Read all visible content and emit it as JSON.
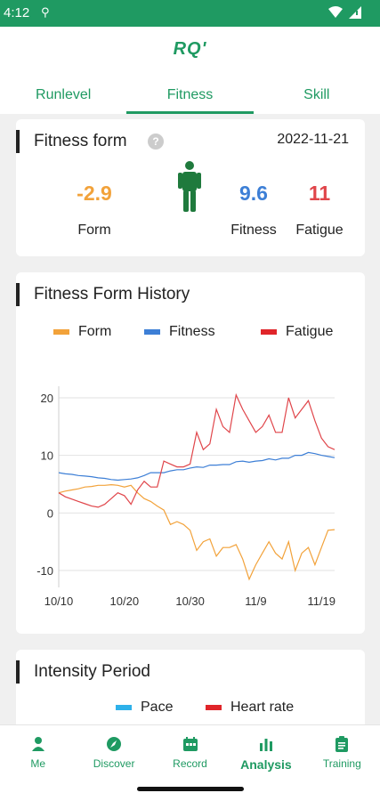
{
  "status_bar": {
    "time": "4:12",
    "usb_icon": "usb-icon"
  },
  "header": {
    "logo": "RQ'"
  },
  "tabs": [
    {
      "label": "Runlevel",
      "active": false
    },
    {
      "label": "Fitness",
      "active": true
    },
    {
      "label": "Skill",
      "active": false
    }
  ],
  "fitness_form": {
    "title": "Fitness form",
    "date": "2022-11-21",
    "form": {
      "value": "-2.9",
      "label": "Form",
      "color": "#f2a23a"
    },
    "fitness": {
      "value": "9.6",
      "label": "Fitness",
      "color": "#3d7fd6"
    },
    "fatigue": {
      "value": "11",
      "label": "Fatigue",
      "color": "#e0454a"
    },
    "person_color": "#1f7a3d"
  },
  "history": {
    "title": "Fitness Form History",
    "legend": [
      {
        "name": "Form",
        "color": "#f2a23a"
      },
      {
        "name": "Fitness",
        "color": "#3d7fd6"
      },
      {
        "name": "Fatigue",
        "color": "#e0454a"
      }
    ]
  },
  "chart_data": {
    "type": "line",
    "x": [
      "10/10",
      "10/11",
      "10/12",
      "10/13",
      "10/14",
      "10/15",
      "10/16",
      "10/17",
      "10/18",
      "10/19",
      "10/20",
      "10/21",
      "10/22",
      "10/23",
      "10/24",
      "10/25",
      "10/26",
      "10/27",
      "10/28",
      "10/29",
      "10/30",
      "10/31",
      "11/1",
      "11/2",
      "11/3",
      "11/4",
      "11/5",
      "11/6",
      "11/7",
      "11/8",
      "11/9",
      "11/10",
      "11/11",
      "11/12",
      "11/13",
      "11/14",
      "11/15",
      "11/16",
      "11/17",
      "11/18",
      "11/19",
      "11/20",
      "11/21"
    ],
    "xticks": [
      "10/10",
      "10/20",
      "10/30",
      "11/9",
      "11/19"
    ],
    "yticks": [
      -10,
      0,
      10,
      20
    ],
    "ylim": [
      -12,
      22
    ],
    "series": [
      {
        "name": "Form",
        "color": "#f2a23a",
        "values": [
          3.5,
          3.8,
          4.0,
          4.2,
          4.5,
          4.6,
          4.8,
          4.8,
          4.9,
          4.8,
          4.5,
          4.8,
          3.5,
          2.5,
          2.0,
          1.2,
          0.5,
          -2.0,
          -1.5,
          -2.0,
          -3.0,
          -6.5,
          -5.0,
          -4.5,
          -7.5,
          -6.0,
          -6.0,
          -5.5,
          -8.0,
          -11.5,
          -9.0,
          -7.0,
          -5.0,
          -7.0,
          -8.0,
          -5.0,
          -10.0,
          -7.0,
          -6.0,
          -9.0,
          -6.0,
          -3.0,
          -2.9
        ]
      },
      {
        "name": "Fitness",
        "color": "#3d7fd6",
        "values": [
          7.0,
          6.8,
          6.7,
          6.5,
          6.4,
          6.3,
          6.1,
          6.0,
          5.8,
          5.7,
          5.8,
          5.9,
          6.1,
          6.5,
          7.0,
          7.0,
          7.0,
          7.3,
          7.5,
          7.5,
          7.8,
          8.0,
          7.9,
          8.3,
          8.3,
          8.4,
          8.4,
          8.9,
          9.0,
          8.8,
          9.0,
          9.1,
          9.4,
          9.2,
          9.5,
          9.5,
          10.0,
          10.0,
          10.5,
          10.3,
          10.0,
          9.8,
          9.6
        ]
      },
      {
        "name": "Fatigue",
        "color": "#e0454a",
        "values": [
          3.5,
          2.8,
          2.4,
          2.0,
          1.6,
          1.2,
          1.0,
          1.5,
          2.5,
          3.5,
          3.0,
          1.5,
          4.0,
          5.5,
          4.5,
          4.5,
          9.0,
          8.5,
          8.0,
          8.0,
          8.5,
          14.0,
          11.0,
          12.0,
          18.0,
          15.0,
          14.0,
          20.5,
          18.0,
          16.0,
          14.0,
          15.0,
          17.0,
          14.0,
          14.0,
          20.0,
          16.5,
          18.0,
          19.5,
          16.0,
          13.0,
          11.5,
          11.0
        ]
      }
    ]
  },
  "intensity": {
    "title": "Intensity Period",
    "legend": [
      {
        "name": "Pace",
        "color": "#2eb1ea"
      },
      {
        "name": "Heart rate",
        "color": "#e0252a"
      }
    ]
  },
  "bottom_nav": [
    {
      "label": "Me",
      "icon": "person-icon",
      "active": false
    },
    {
      "label": "Discover",
      "icon": "compass-icon",
      "active": false
    },
    {
      "label": "Record",
      "icon": "calendar-icon",
      "active": false
    },
    {
      "label": "Analysis",
      "icon": "bar-chart-icon",
      "active": true
    },
    {
      "label": "Training",
      "icon": "clipboard-icon",
      "active": false
    }
  ]
}
